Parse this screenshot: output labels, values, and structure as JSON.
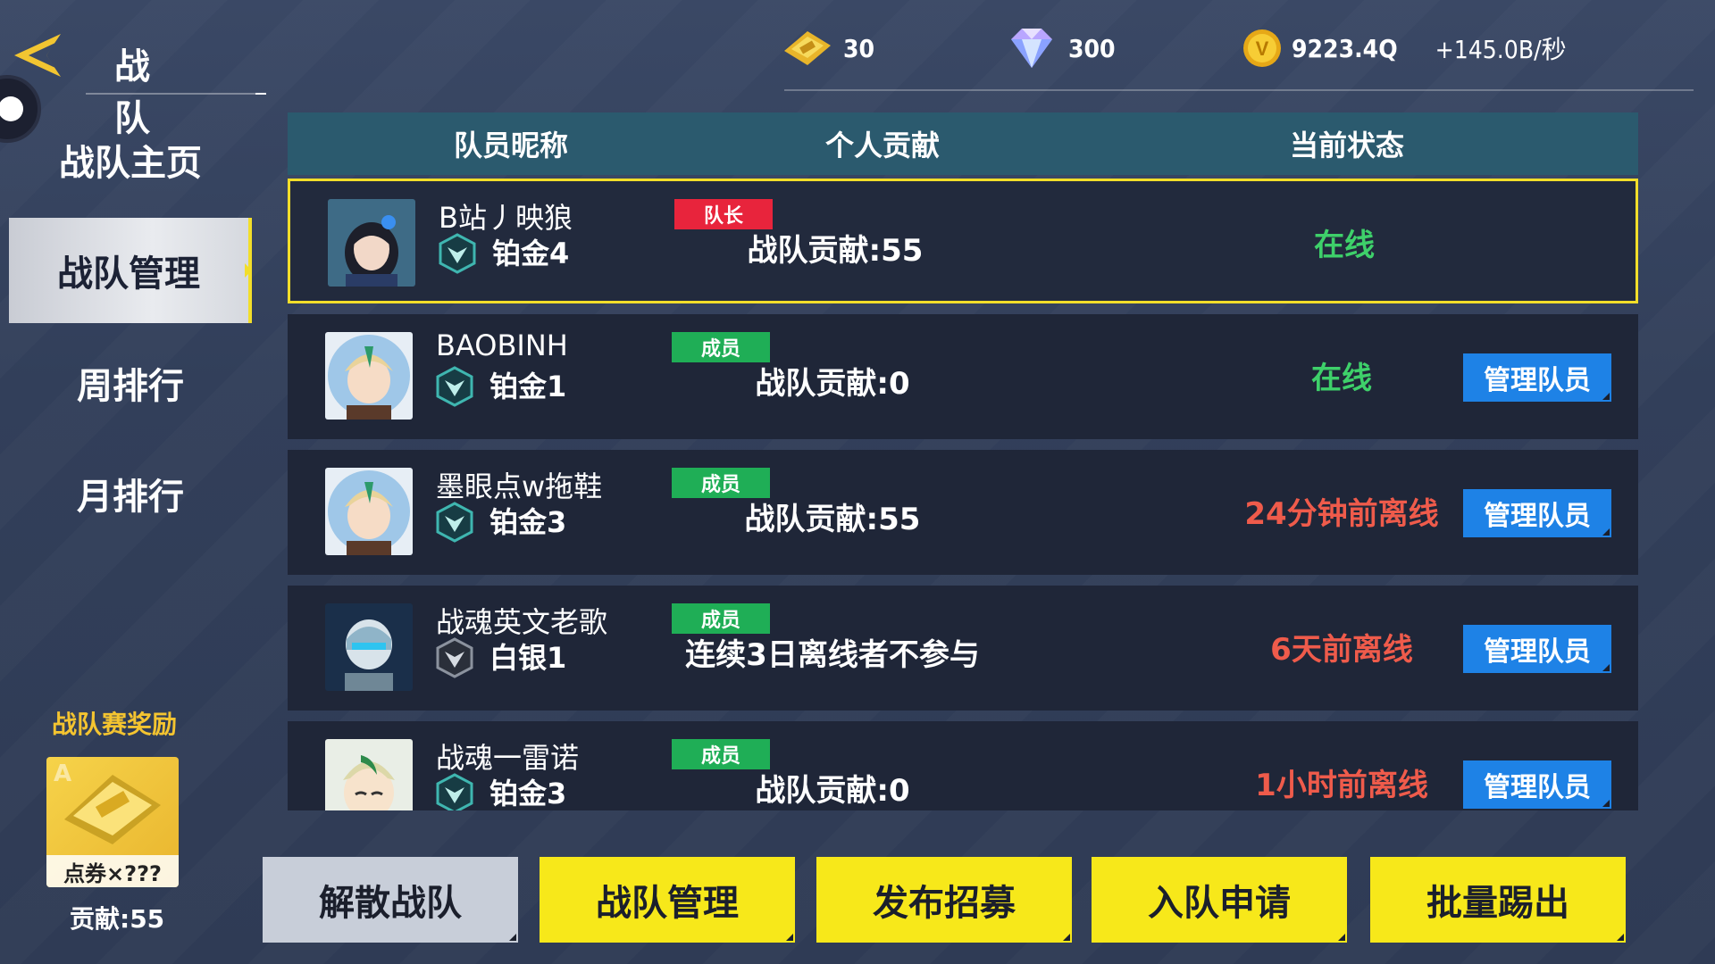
{
  "header": {
    "title": "战 队",
    "currencies": [
      {
        "icon": "ticket-icon",
        "value": "30"
      },
      {
        "icon": "diamond-icon",
        "value": "300"
      },
      {
        "icon": "gold-coin-icon",
        "value": "9223.4Q"
      }
    ],
    "income_rate": "+145.0B/秒"
  },
  "sidebar": {
    "items": [
      {
        "label": "战队主页",
        "active": false
      },
      {
        "label": "战队管理",
        "active": true
      },
      {
        "label": "周排行",
        "active": false
      },
      {
        "label": "月排行",
        "active": false
      }
    ],
    "reward": {
      "title": "战队赛奖励",
      "card_label": "点券×???",
      "contribution": "贡献:55"
    }
  },
  "table": {
    "headers": [
      "队员昵称",
      "个人贡献",
      "当前状态"
    ],
    "rows": [
      {
        "name": "B站丿映狼",
        "rank": "铂金4",
        "role": "队长",
        "contribution": "战队贡献:55",
        "status": "在线",
        "status_type": "online",
        "manage": ""
      },
      {
        "name": "BAOBINH",
        "rank": "铂金1",
        "role": "成员",
        "contribution": "战队贡献:0",
        "status": "在线",
        "status_type": "online",
        "manage": "管理队员"
      },
      {
        "name": "墨眼点w拖鞋",
        "rank": "铂金3",
        "role": "成员",
        "contribution": "战队贡献:55",
        "status": "24分钟前离线",
        "status_type": "offline",
        "manage": "管理队员"
      },
      {
        "name": "战魂英文老歌",
        "rank": "白银1",
        "role": "成员",
        "contribution": "连续3日离线者不参与",
        "status": "6天前离线",
        "status_type": "offline",
        "manage": "管理队员"
      },
      {
        "name": "战魂一雷诺",
        "rank": "铂金3",
        "role": "成员",
        "contribution": "战队贡献:0",
        "status": "1小时前离线",
        "status_type": "offline",
        "manage": "管理队员"
      }
    ]
  },
  "footer": {
    "buttons": [
      "解散战队",
      "战队管理",
      "发布招募",
      "入队申请",
      "批量踢出"
    ]
  },
  "colors": {
    "accent_yellow": "#f7e81a",
    "online_green": "#3ed06a",
    "offline_red": "#ef5b4b",
    "manage_blue": "#1e82e6",
    "leader_badge": "#e8243c",
    "member_badge": "#1fae56"
  }
}
